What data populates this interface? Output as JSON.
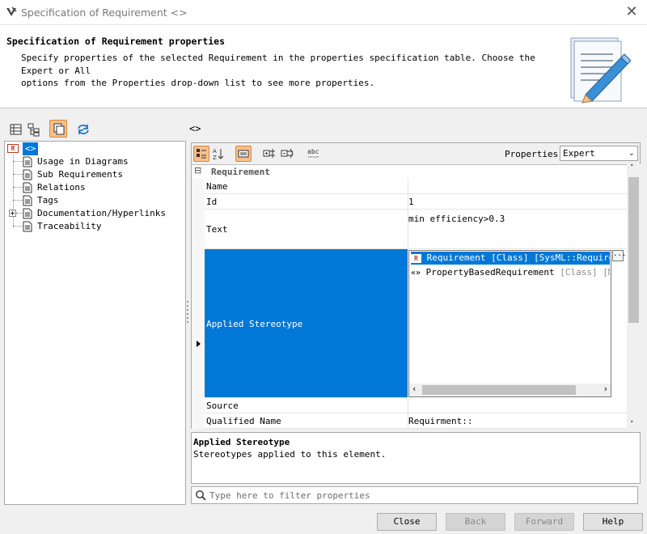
{
  "window": {
    "title": "Specification of Requirement <>",
    "close_glyph": "✕"
  },
  "header": {
    "title": "Specification of Requirement properties",
    "description": "Specify properties of the selected Requirement in the properties specification table. Choose the Expert or All\noptions from the Properties drop-down list to see more properties."
  },
  "left_toolbar": {
    "icons": [
      "table-view-icon",
      "tree-view-icon",
      "copy-icon",
      "refresh-icon"
    ],
    "active": "copy-icon"
  },
  "tree": {
    "root_label": "<>",
    "root_badge": "R",
    "items": [
      {
        "label": "Usage in Diagrams",
        "expandable": false
      },
      {
        "label": "Sub Requirements",
        "expandable": false
      },
      {
        "label": "Relations",
        "expandable": false
      },
      {
        "label": "Tags",
        "expandable": false
      },
      {
        "label": "Documentation/Hyperlinks",
        "expandable": true
      },
      {
        "label": "Traceability",
        "expandable": false
      }
    ]
  },
  "element": {
    "label": "<>"
  },
  "properties_panel": {
    "properties_label": "Properties:",
    "properties_value": "Expert",
    "group": {
      "label": "Requirement",
      "toggle": "⊟"
    },
    "rows": [
      {
        "name": "Name",
        "value": ""
      },
      {
        "name": "Id",
        "value": "1"
      },
      {
        "name": "Text",
        "value": "min efficiency>0.3"
      },
      {
        "name": "Applied Stereotype",
        "value": ""
      },
      {
        "name": "Source",
        "value": ""
      },
      {
        "name": "Qualified Name",
        "value": "Requirment::"
      }
    ],
    "stereotypes": [
      {
        "icon": "R",
        "name": "Requirement",
        "meta": "[Class] [SysML::Requirements]"
      },
      {
        "icon": "«»",
        "name": "PropertyBasedRequirement",
        "meta": "[Class] [MBSE]"
      }
    ],
    "ellipsis": "..."
  },
  "description": {
    "title": "Applied Stereotype",
    "text": "Stereotypes applied to this element."
  },
  "filter": {
    "placeholder": "Type here to filter properties"
  },
  "buttons": {
    "close": "Close",
    "back": "Back",
    "forward": "Forward",
    "help": "Help"
  },
  "colors": {
    "selection": "#0078d7",
    "active_button": "#f6c08a",
    "requirement_badge": "#c0392b"
  }
}
